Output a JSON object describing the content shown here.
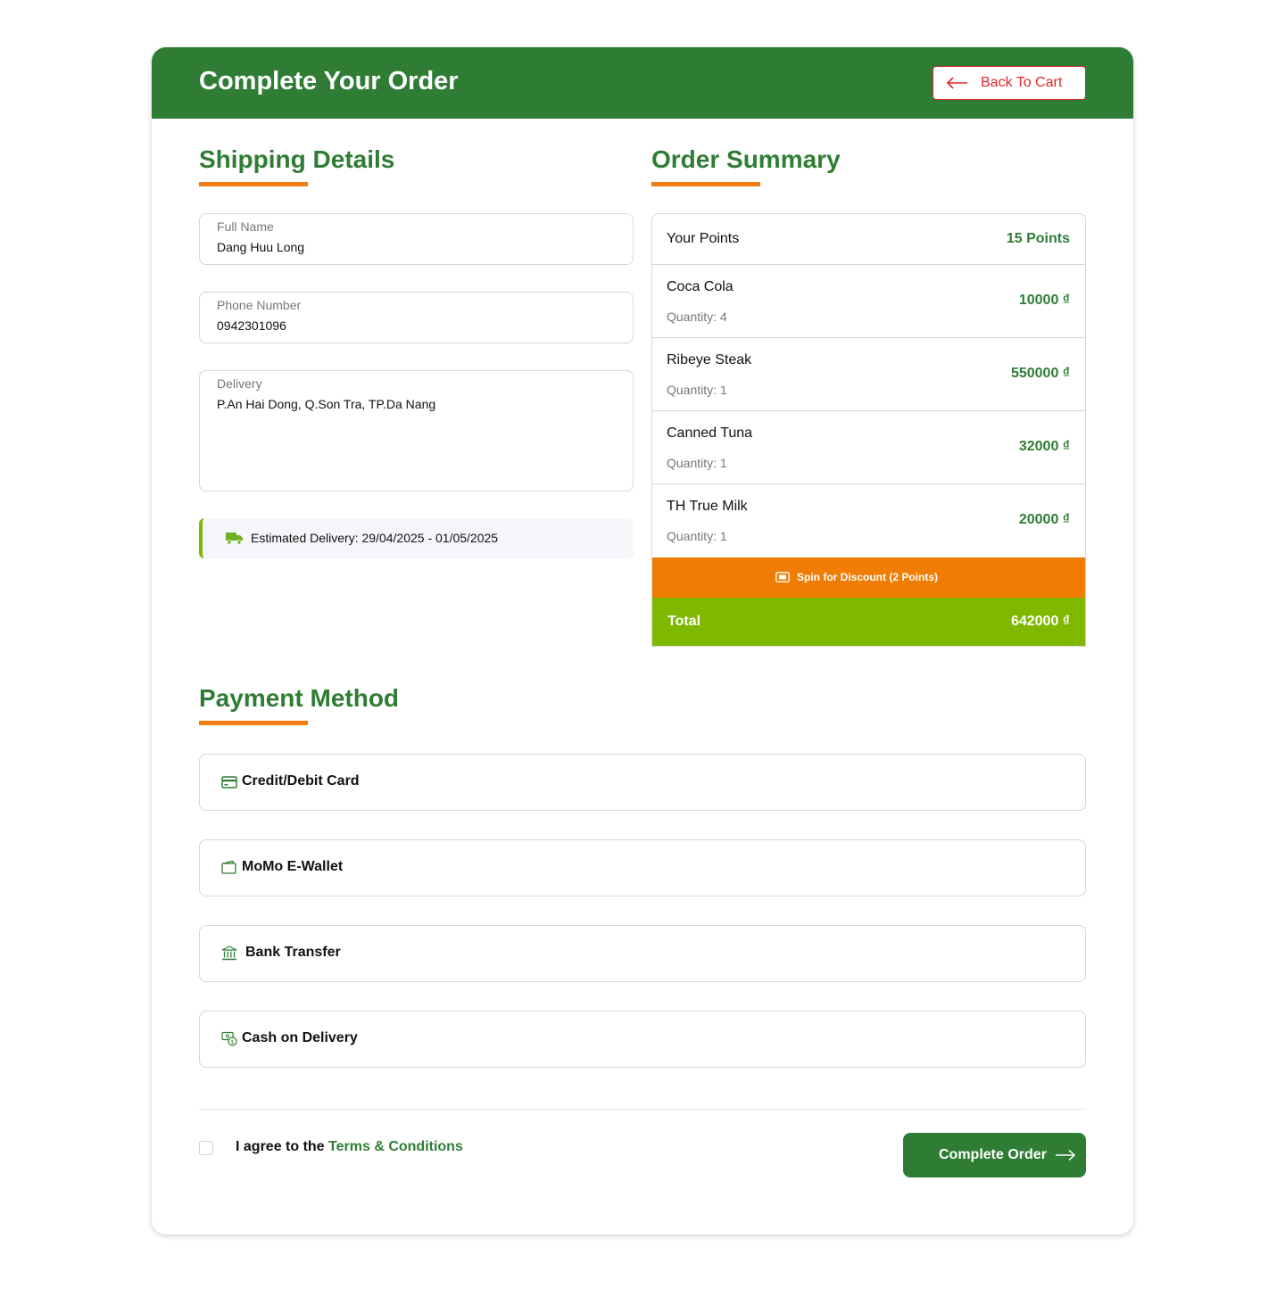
{
  "header": {
    "title": "Complete Your Order",
    "back_button": "Back To Cart"
  },
  "shipping": {
    "title": "Shipping Details",
    "full_name_label": "Full Name",
    "full_name_value": "Dang Huu Long",
    "phone_label": "Phone Number",
    "phone_value": "0942301096",
    "delivery_label": "Delivery",
    "delivery_value": "P.An Hai Dong, Q.Son Tra, TP.Da Nang",
    "estimated_delivery": "Estimated Delivery: 29/04/2025 - 01/05/2025"
  },
  "summary": {
    "title": "Order Summary",
    "points_label": "Your Points",
    "points_value": "15 Points",
    "items": [
      {
        "name": "Coca Cola",
        "quantity": "Quantity: 4",
        "price": "10000 ₫"
      },
      {
        "name": "Ribeye Steak",
        "quantity": "Quantity: 1",
        "price": "550000 ₫"
      },
      {
        "name": "Canned Tuna",
        "quantity": "Quantity: 1",
        "price": "32000 ₫"
      },
      {
        "name": "TH True Milk",
        "quantity": "Quantity: 1",
        "price": "20000 ₫"
      }
    ],
    "spin_label": "Spin for Discount (2 Points)",
    "total_label": "Total",
    "total_value": "642000 ₫"
  },
  "payment": {
    "title": "Payment Method",
    "methods": [
      {
        "label": "Credit/Debit Card",
        "icon": "credit-card-icon"
      },
      {
        "label": "MoMo E-Wallet",
        "icon": "wallet-icon"
      },
      {
        "label": "Bank Transfer",
        "icon": "bank-icon"
      },
      {
        "label": "Cash on Delivery",
        "icon": "cash-icon"
      }
    ]
  },
  "footer": {
    "agree_prefix": "I agree to the ",
    "terms_link": "Terms & Conditions",
    "complete_button": "Complete Order"
  },
  "colors": {
    "brand_green": "#2f7d35",
    "accent_orange": "#f07c03",
    "total_green": "#80b800",
    "back_red": "#e0262b"
  }
}
